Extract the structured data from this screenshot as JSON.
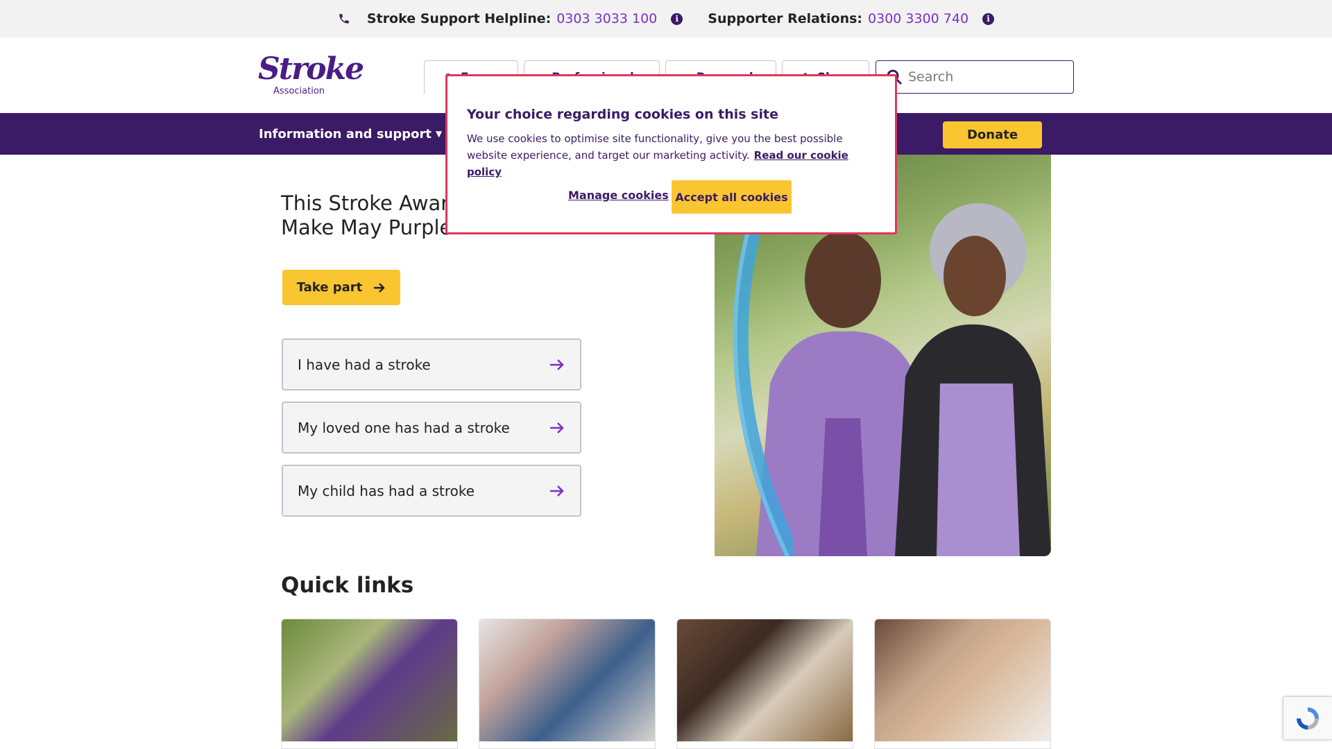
{
  "topbar": {
    "helpline_label": "Stroke Support Helpline:",
    "helpline_number": "0303 3033 100",
    "supporter_label": "Supporter Relations:",
    "supporter_number": "0300 3300 740"
  },
  "header": {
    "logo_word": "Stroke",
    "logo_sub": "Association",
    "tabs": [
      {
        "label": "F",
        "icon": "user-icon"
      },
      {
        "label": "Professionals",
        "icon": "clipboard-icon"
      },
      {
        "label": "Research",
        "icon": "flask-icon"
      },
      {
        "label": "Shop",
        "icon": "shop-icon"
      }
    ],
    "search_placeholder": "Search"
  },
  "nav": {
    "menu_label": "Information and support",
    "donate_label": "Donate"
  },
  "hero": {
    "title_line1": "This Stroke Aware",
    "title_line2": "Make May Purple",
    "take_part_label": "Take part",
    "paths": [
      "I have had a stroke",
      "My loved one has had a stroke",
      "My child has had a stroke"
    ]
  },
  "quick_links": {
    "title": "Quick links"
  },
  "cookie": {
    "title": "Your choice regarding cookies on this site",
    "body": "We use cookies to optimise site functionality, give you the best possible website experience, and target our marketing activity.",
    "policy_link": "Read our cookie policy",
    "manage_label": "Manage cookies",
    "accept_label": "Accept all cookies"
  },
  "colors": {
    "brand_purple": "#3b1a66",
    "accent_yellow": "#f9c530",
    "link_purple": "#7b2fc9",
    "modal_border": "#e0365c"
  }
}
